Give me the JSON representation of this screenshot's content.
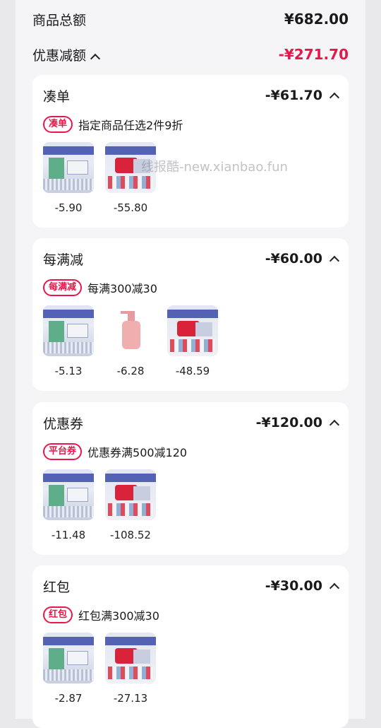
{
  "summary": {
    "total_label": "商品总额",
    "total_value": "¥682.00",
    "discount_label": "优惠减额",
    "discount_value": "-¥271.70"
  },
  "watermark": "线报酷-new.xianbao.fun",
  "cards": [
    {
      "title": "凑单",
      "amount": "-¥61.70",
      "tag": "凑单",
      "rule": "指定商品任选2件9折",
      "products": [
        {
          "icon": "serum-set-image",
          "price": "-5.90"
        },
        {
          "icon": "cream-set-image",
          "price": "-55.80"
        }
      ]
    },
    {
      "title": "每满减",
      "amount": "-¥60.00",
      "tag": "每满减",
      "rule": "每满300减30",
      "products": [
        {
          "icon": "serum-set-image",
          "price": "-5.13"
        },
        {
          "icon": "lotion-bottle-image",
          "price": "-6.28"
        },
        {
          "icon": "cream-set-image",
          "price": "-48.59"
        }
      ]
    },
    {
      "title": "优惠券",
      "amount": "-¥120.00",
      "tag": "平台券",
      "rule": "优惠券满500减120",
      "products": [
        {
          "icon": "serum-set-image",
          "price": "-11.48"
        },
        {
          "icon": "cream-set-image",
          "price": "-108.52"
        }
      ]
    },
    {
      "title": "红包",
      "amount": "-¥30.00",
      "tag": "红包",
      "rule": "红包满300减30",
      "products": [
        {
          "icon": "serum-set-image",
          "price": "-2.87"
        },
        {
          "icon": "cream-set-image",
          "price": "-27.13"
        }
      ]
    }
  ],
  "colors": {
    "accent": "#e8174b",
    "card_bg": "#ffffff",
    "page_bg": "#f5f5f7"
  }
}
